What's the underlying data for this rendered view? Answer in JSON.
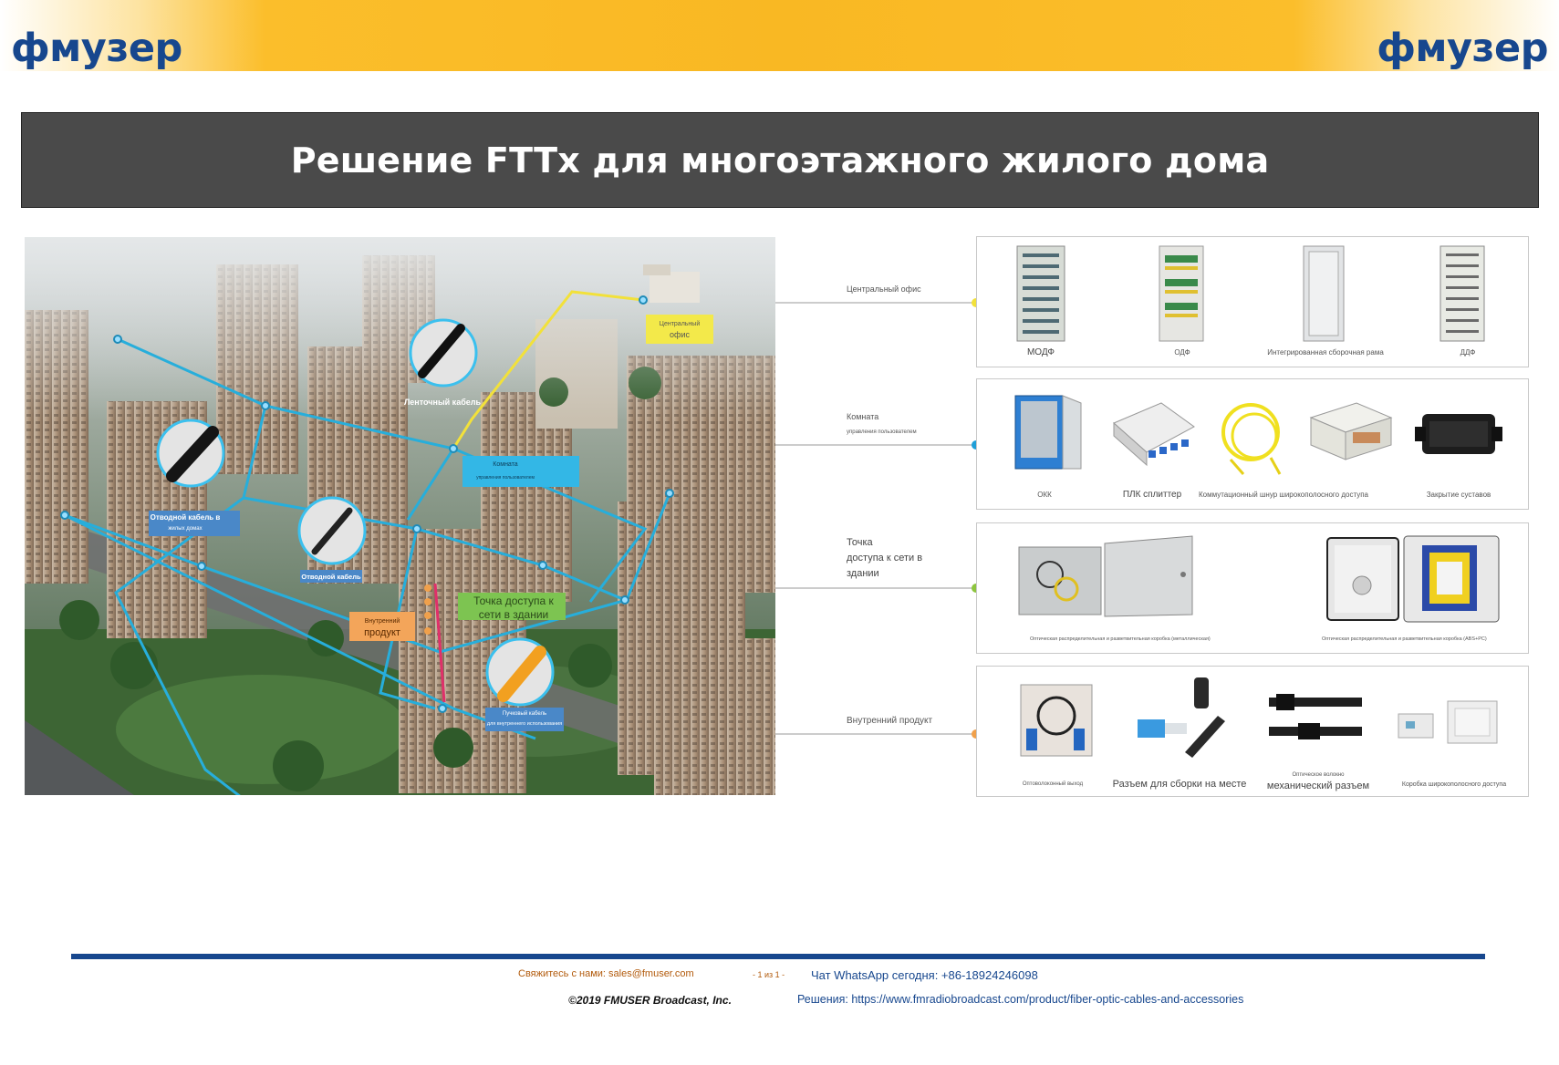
{
  "brand": {
    "logo_text": "фмузер"
  },
  "title": "Решение FTTx для многоэтажного жилого дома",
  "scene_labels": {
    "central_office": "Центральный офис",
    "control_room_l1": "Комната",
    "control_room_l2": "управления пользователем",
    "ribbon_cable": "Ленточный кабель",
    "drop_cable_house_l1": "Отводной кабель в",
    "drop_cable_house_l2": "жилых домах",
    "drop_cable": "Отводной кабель",
    "access_point": "Точка доступа к сети в здании",
    "indoor_product_l1": "Внутренний",
    "indoor_product_l2": "продукт",
    "bundle_cable_l1": "Пучковый кабель",
    "bundle_cable_l2": "для внутреннего использования"
  },
  "connectors": [
    {
      "lines": [
        "Центральный офис"
      ],
      "color": "#f2e13a"
    },
    {
      "lines": [
        "Комната",
        "управления пользователем"
      ],
      "color": "#1e9fd8"
    },
    {
      "lines": [
        "Точка",
        "доступа к сети в",
        "здании"
      ],
      "color": "#8dc53e"
    },
    {
      "lines": [
        "Внутренний продукт"
      ],
      "color": "#f0a04b"
    }
  ],
  "panels": [
    {
      "items": [
        "МОДФ",
        "ОДФ",
        "Интегрированная сборочная рама",
        "ДДФ"
      ]
    },
    {
      "items": [
        "ОКК",
        "ПЛК сплиттер",
        "Коммутационный шнур широкополосного доступа",
        "Закрытие суставов"
      ]
    },
    {
      "items": [
        "Оптическая распределительная и разветвительная коробка (металлическая)",
        "Оптическая распределительная и разветвительная коробка (ABS+PC)"
      ]
    },
    {
      "items": [
        "Оптоволоконный выход",
        "Разъем для сборки на месте",
        "Оптическое волокно",
        "механический разъем",
        "Коробка широкополосного доступа"
      ]
    }
  ],
  "footer": {
    "contact": "Свяжитесь с нами: sales@fmuser.com",
    "page": "- 1 из 1 -",
    "whatsapp": "Чат WhatsApp сегодня: +86-18924246098",
    "copyright": "©2019 FMUSER Broadcast, Inc.",
    "solutions": "Решения: https://www.fmradiobroadcast.com/product/fiber-optic-cables-and-accessories"
  },
  "colors": {
    "brand_blue": "#17478e",
    "banner_orange": "#f9b823",
    "title_bar": "#4a4a4a",
    "cable_blue": "#27aedb",
    "cable_yellow": "#f2e13a"
  }
}
